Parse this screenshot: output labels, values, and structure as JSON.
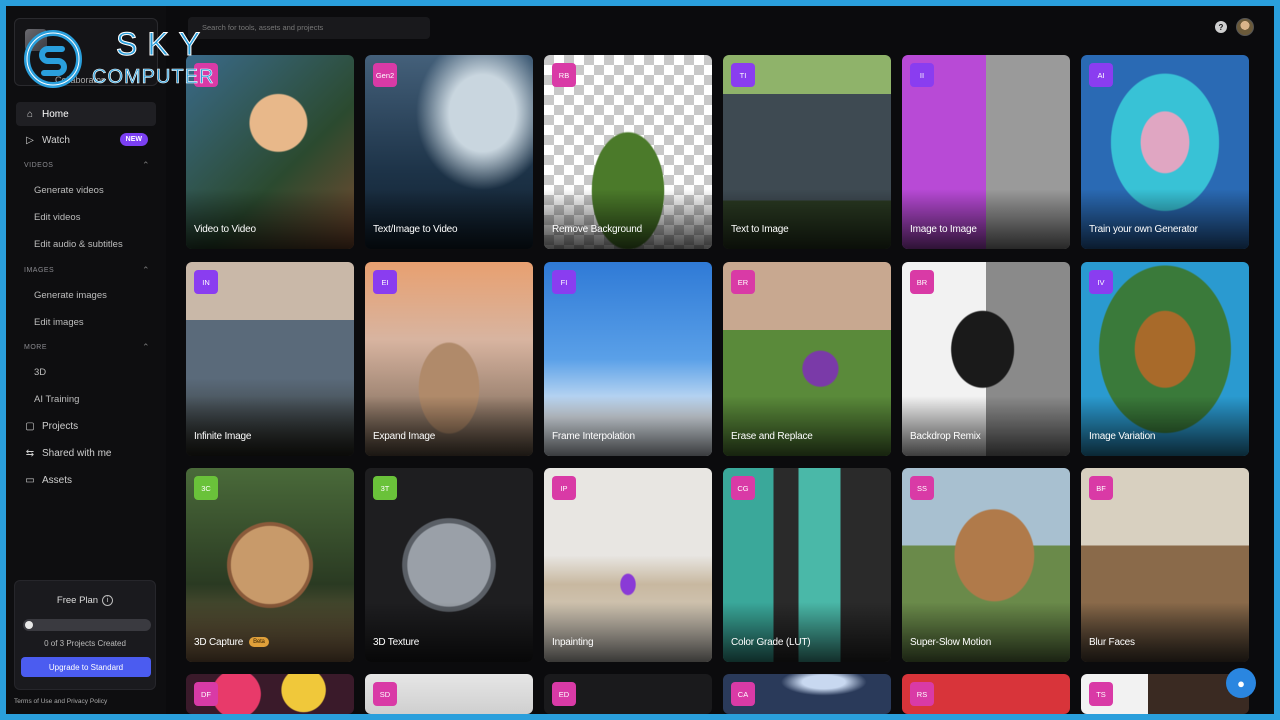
{
  "workspace": {
    "name": "Collaborator"
  },
  "watermark": {
    "line1": "SKY",
    "line2": "COMPUTER"
  },
  "search": {
    "placeholder": "Search for tools, assets and projects"
  },
  "nav": {
    "home": "Home",
    "watch": "Watch",
    "watch_badge": "NEW",
    "projects": "Projects",
    "shared": "Shared with me",
    "assets": "Assets"
  },
  "sections": {
    "videos": {
      "title": "VIDEOS",
      "items": [
        "Generate videos",
        "Edit videos",
        "Edit audio & subtitles"
      ]
    },
    "images": {
      "title": "IMAGES",
      "items": [
        "Generate images",
        "Edit images"
      ]
    },
    "more": {
      "title": "MORE",
      "items": [
        "3D",
        "AI Training"
      ]
    }
  },
  "plan": {
    "title": "Free Plan",
    "count": "0 of 3 Projects Created",
    "progress": 0,
    "button": "Upgrade to Standard"
  },
  "footer": "Terms of Use and Privacy Policy",
  "cards": [
    {
      "badge": "",
      "label": "Video to Video"
    },
    {
      "badge": "Gen2",
      "label": "Text/Image to Video"
    },
    {
      "badge": "RB",
      "label": "Remove Background"
    },
    {
      "badge": "TI",
      "label": "Text to Image"
    },
    {
      "badge": "II",
      "label": "Image to Image"
    },
    {
      "badge": "AI",
      "label": "Train your own Generator"
    },
    {
      "badge": "IN",
      "label": "Infinite Image"
    },
    {
      "badge": "EI",
      "label": "Expand Image"
    },
    {
      "badge": "FI",
      "label": "Frame Interpolation"
    },
    {
      "badge": "ER",
      "label": "Erase and Replace"
    },
    {
      "badge": "BR",
      "label": "Backdrop Remix"
    },
    {
      "badge": "IV",
      "label": "Image Variation"
    },
    {
      "badge": "3C",
      "label": "3D Capture",
      "tag": "Beta"
    },
    {
      "badge": "3T",
      "label": "3D Texture"
    },
    {
      "badge": "IP",
      "label": "Inpainting"
    },
    {
      "badge": "CG",
      "label": "Color Grade (LUT)"
    },
    {
      "badge": "SS",
      "label": "Super-Slow Motion"
    },
    {
      "badge": "BF",
      "label": "Blur Faces"
    },
    {
      "badge": "DF",
      "label": ""
    },
    {
      "badge": "SD",
      "label": ""
    },
    {
      "badge": "ED",
      "label": ""
    },
    {
      "badge": "CA",
      "label": ""
    },
    {
      "badge": "RS",
      "label": ""
    },
    {
      "badge": "TS",
      "label": ""
    }
  ],
  "icons": {
    "help": "?",
    "chat": "chat-bubble-icon"
  }
}
